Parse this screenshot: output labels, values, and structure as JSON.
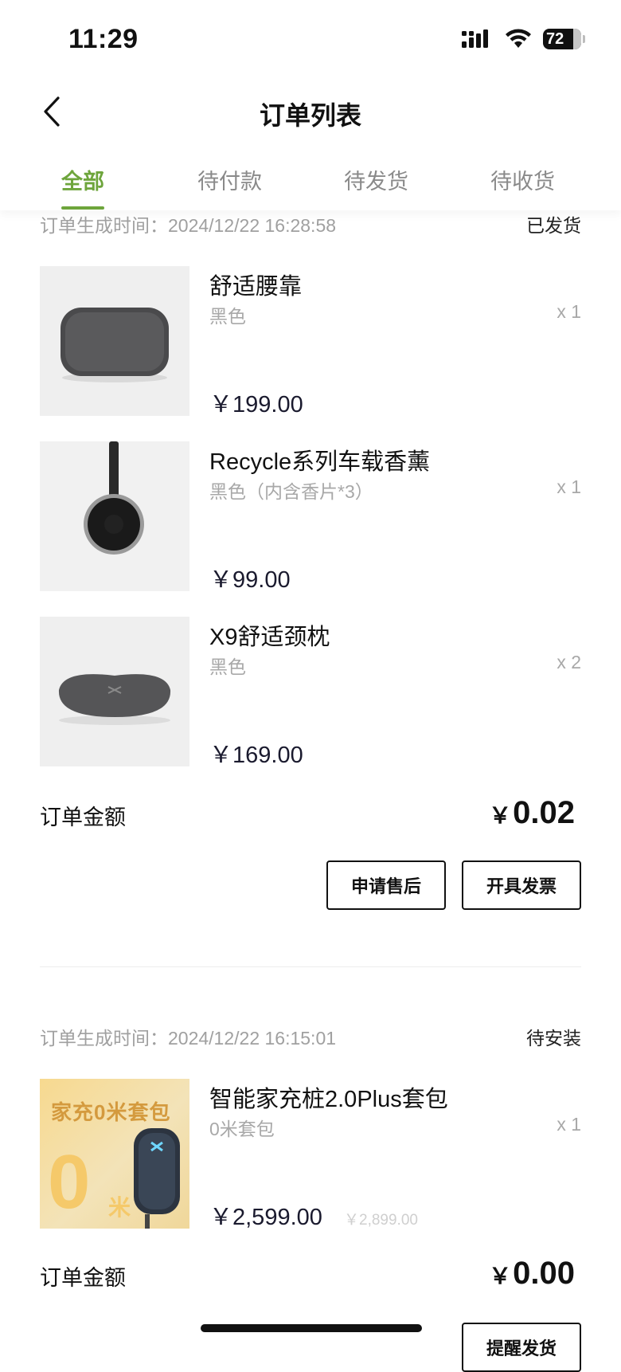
{
  "status_bar": {
    "time": "11:29",
    "battery": "72"
  },
  "header": {
    "title": "订单列表"
  },
  "tabs": [
    {
      "label": "全部",
      "active": true
    },
    {
      "label": "待付款",
      "active": false
    },
    {
      "label": "待发货",
      "active": false
    },
    {
      "label": "待收货",
      "active": false
    }
  ],
  "orders": [
    {
      "created_label": "订单生成时间：",
      "created_time": "2024/12/22 16:28:58",
      "status": "已发货",
      "items": [
        {
          "name": "舒适腰靠",
          "spec": "黑色",
          "qty": "x 1",
          "price": "￥199.00"
        },
        {
          "name": "Recycle系列车载香薰",
          "spec": "黑色（内含香片*3）",
          "qty": "x 1",
          "price": "￥99.00"
        },
        {
          "name": "X9舒适颈枕",
          "spec": "黑色",
          "qty": "x 2",
          "price": "￥169.00"
        }
      ],
      "total_label": "订单金额",
      "total_currency": "￥",
      "total_value": "0.02",
      "actions": [
        "申请售后",
        "开具发票"
      ]
    },
    {
      "created_label": "订单生成时间：",
      "created_time": "2024/12/22 16:15:01",
      "status": "待安装",
      "items": [
        {
          "name": "智能家充桩2.0Plus套包",
          "spec": "0米套包",
          "qty": "x 1",
          "price": "￥2,599.00",
          "original_price": "￥2,899.00",
          "thumb_text": "家充0米套包",
          "thumb_big": "0",
          "thumb_small": "米"
        }
      ],
      "total_label": "订单金额",
      "total_currency": "￥",
      "total_value": "0.00",
      "actions": [
        "提醒发货"
      ]
    }
  ],
  "colors": {
    "accent": "#6ea53c",
    "muted": "#a8a8a8"
  }
}
